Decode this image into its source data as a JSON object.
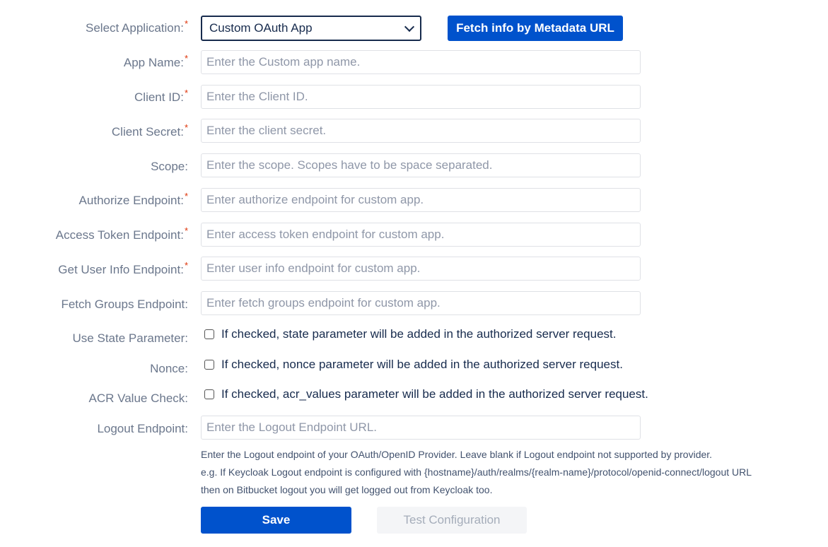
{
  "form": {
    "select_application": {
      "label": "Select Application:",
      "required": "*",
      "value": "Custom OAuth App"
    },
    "fetch_button": "Fetch info by Metadata URL",
    "app_name": {
      "label": "App Name:",
      "required": "*",
      "placeholder": "Enter the Custom app name.",
      "value": ""
    },
    "client_id": {
      "label": "Client ID:",
      "required": "*",
      "placeholder": "Enter the Client ID.",
      "value": ""
    },
    "client_secret": {
      "label": "Client Secret:",
      "required": "*",
      "placeholder": "Enter the client secret.",
      "value": ""
    },
    "scope": {
      "label": "Scope:",
      "placeholder": "Enter the scope. Scopes have to be space separated.",
      "value": ""
    },
    "authorize_endpoint": {
      "label": "Authorize Endpoint:",
      "required": "*",
      "placeholder": "Enter authorize endpoint for custom app.",
      "value": ""
    },
    "access_token_endpoint": {
      "label": "Access Token Endpoint:",
      "required": "*",
      "placeholder": "Enter access token endpoint for custom app.",
      "value": ""
    },
    "user_info_endpoint": {
      "label": "Get User Info Endpoint:",
      "required": "*",
      "placeholder": "Enter user info endpoint for custom app.",
      "value": ""
    },
    "fetch_groups_endpoint": {
      "label": "Fetch Groups Endpoint:",
      "placeholder": "Enter fetch groups endpoint for custom app.",
      "value": ""
    },
    "use_state": {
      "label": "Use State Parameter:",
      "text": "If checked, state parameter will be added in the authorized server request.",
      "checked": false
    },
    "nonce": {
      "label": "Nonce:",
      "text": "If checked, nonce parameter will be added in the authorized server request.",
      "checked": false
    },
    "acr_value": {
      "label": "ACR Value Check:",
      "text": "If checked, acr_values parameter will be added in the authorized server request.",
      "checked": false
    },
    "logout_endpoint": {
      "label": "Logout Endpoint:",
      "placeholder": "Enter the Logout Endpoint URL.",
      "value": ""
    },
    "logout_help": [
      "Enter the Logout endpoint of your OAuth/OpenID Provider. Leave blank if Logout endpoint not supported by provider.",
      "e.g. If Keycloak Logout endpoint is configured with {hostname}/auth/realms/{realm-name}/protocol/openid-connect/logout URL",
      "then on Bitbucket logout you will get logged out from Keycloak too."
    ],
    "save_button": "Save",
    "test_button": "Test Configuration"
  },
  "colors": {
    "primary": "#0052cc",
    "required": "#de350b",
    "label": "#6b778c"
  }
}
